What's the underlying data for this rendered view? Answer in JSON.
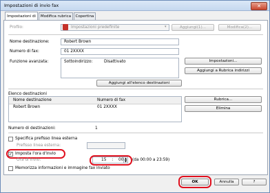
{
  "window": {
    "title": "Impostazioni di invio fax"
  },
  "tabs": [
    {
      "label": "Impostazioni di invio"
    },
    {
      "label": "Modifica rubrica"
    },
    {
      "label": "Copertina"
    }
  ],
  "profile": {
    "label": "Profilo:",
    "value": "Impostazioni predefinite",
    "add_label": "Aggiungi(1)...",
    "edit_label": "Modifica(2)..."
  },
  "destination": {
    "name_label": "Nome destinazione:",
    "name_value": "Robert Brown",
    "fax_label": "Numero di fax:",
    "fax_value": "01 2XXXX",
    "advanced_label": "Funzione avanzata:",
    "subaddress_label": "Sottoindirizzo:",
    "subaddress_value": "Disattivato",
    "settings_button": "Impostazioni...",
    "add_to_book_button": "Aggiungi a Rubrica indirizzi",
    "add_to_list_button": "Aggiungi all'elenco destinazioni"
  },
  "list": {
    "title": "Elenco destinazioni",
    "col_name": "Nome destinazione",
    "col_fax": "Numero di fax",
    "rows": [
      {
        "name": "Robert Brown",
        "fax": "01 2XXXX"
      }
    ],
    "book_button": "Rubrica...",
    "delete_button": "Elimina",
    "count_label": "Numero di destinazioni:",
    "count_value": "1"
  },
  "options": {
    "prefix_label": "Specifica prefisso linea esterna",
    "prefix_field_label": "Prefisso linea esterna:",
    "send_time_label": "Imposta l'ora d'invio",
    "send_time_field_label": "Ora di invio:",
    "hour": "15",
    "separator": ":",
    "minute": "00",
    "range_text": "(da 00:00 a 23:59)",
    "store_label": "Memorizza informazioni e immagine fax inviato",
    "prefix_checked": false,
    "send_time_checked": true,
    "store_checked": false
  },
  "footer": {
    "ok_label": "OK",
    "cancel_label": "Annulla",
    "help_label": "?"
  },
  "colors": {
    "highlight": "#e0101e",
    "titlebar": "#c5d8ef"
  }
}
